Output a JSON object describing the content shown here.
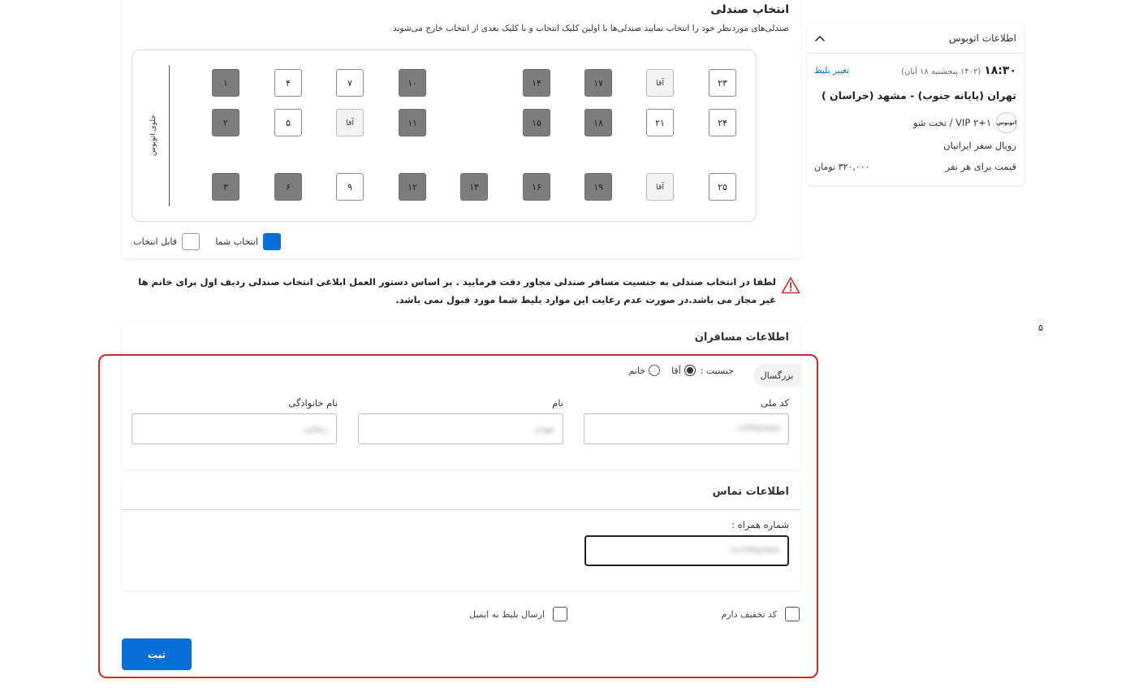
{
  "seat_section": {
    "title": "انتخاب صندلی",
    "description": "صندلی‌های موردنظر خود را انتخاب نمایید صندلی‌ها با اولین کلیک انتخاب و با کلیک بعدی از انتخاب خارج می‌شوند",
    "front_label": "جلوی اتوبوس",
    "male_label": "آقا",
    "seats_booked": [
      "۱",
      "۲",
      "۳",
      "۶",
      "۱۰",
      "۱۱",
      "۱۲",
      "۱۳",
      "۱۴",
      "۱۵",
      "۱۶",
      "۱۷",
      "۱۸",
      "۱۹"
    ],
    "seats_free": [
      "۴",
      "۵",
      "۷",
      "۹",
      "۲۱",
      "۲۳",
      "۲۴",
      "۲۵"
    ],
    "legend_mine": "انتخاب شما",
    "legend_free": "قابل انتخاب"
  },
  "warning": {
    "text": "لطفا در انتخاب صندلی به جنسیت مسافر صندلی مجاور دقت فرمایید . بر اساس دستور العمل ابلاغی انتخاب صندلی ردیف اول برای خانم ها غیر مجاز می باشد.در صورت عدم رعایت این موارد بلیط شما مورد قبول نمی باشد."
  },
  "passenger": {
    "title": "اطلاعات مسافران",
    "adult_tab": "بزرگسال",
    "gender_label": "جنسیت :",
    "male": "آقا",
    "female": "خانم",
    "national_code_label": "کد ملی",
    "national_code_value": "۰۰۱۲۳۴۵۶۷۸۹",
    "first_name_label": "نام",
    "first_name_value": "مهدی",
    "last_name_label": "نام خانوادگی",
    "last_name_value": "رضایی"
  },
  "contact": {
    "title": "اطلاعات تماس",
    "mobile_label": "شماره همراه :",
    "mobile_value": "۰۹۱۲۳۴۵۶۷۸۹"
  },
  "options": {
    "discount_label": "کد تخفیف دارم",
    "email_label": "ارسال بلیط به ایمیل"
  },
  "submit_label": "ثبت",
  "bus_info": {
    "title": "اطلاعات اتوبوس",
    "time": "۱۸:۳۰",
    "date": "(۱۴۰۲ پنجشنبه ۱۸ آبان)",
    "change_ticket": "تغییر بلیط",
    "route": "تهران (پایانه جنوب) - مشهد (خراسان )",
    "logo_text": "اتوبوس",
    "bus_type": "VIP ۲+۱ / تخت شو",
    "company": "رویال سفر ایرانیان",
    "price_label": "قیمت برای هر نفر",
    "price_value": "۳۲۰,۰۰۰ تومان"
  },
  "stray_digit": "۵",
  "colors": {
    "primary": "#0a6fd8",
    "booked_seat": "#7d7d7d",
    "highlight_border": "#d3262b"
  }
}
